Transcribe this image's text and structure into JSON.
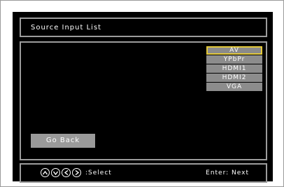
{
  "header": {
    "title": "Source Input List"
  },
  "sources": [
    {
      "label": "AV",
      "selected": true
    },
    {
      "label": "YPbPr",
      "selected": false
    },
    {
      "label": "HDMI1",
      "selected": false
    },
    {
      "label": "HDMI2",
      "selected": false
    },
    {
      "label": "VGA",
      "selected": false
    }
  ],
  "actions": {
    "go_back": "Go Back"
  },
  "footer": {
    "nav_icons": [
      "up-arrow-icon",
      "down-arrow-icon",
      "left-arrow-icon",
      "right-arrow-icon"
    ],
    "select_label": ":Select",
    "enter_label": "Enter: Next"
  },
  "colors": {
    "highlight_border": "#e2c83a",
    "item_background": "#8c8c8c",
    "panel_border": "#9c9c9c"
  }
}
